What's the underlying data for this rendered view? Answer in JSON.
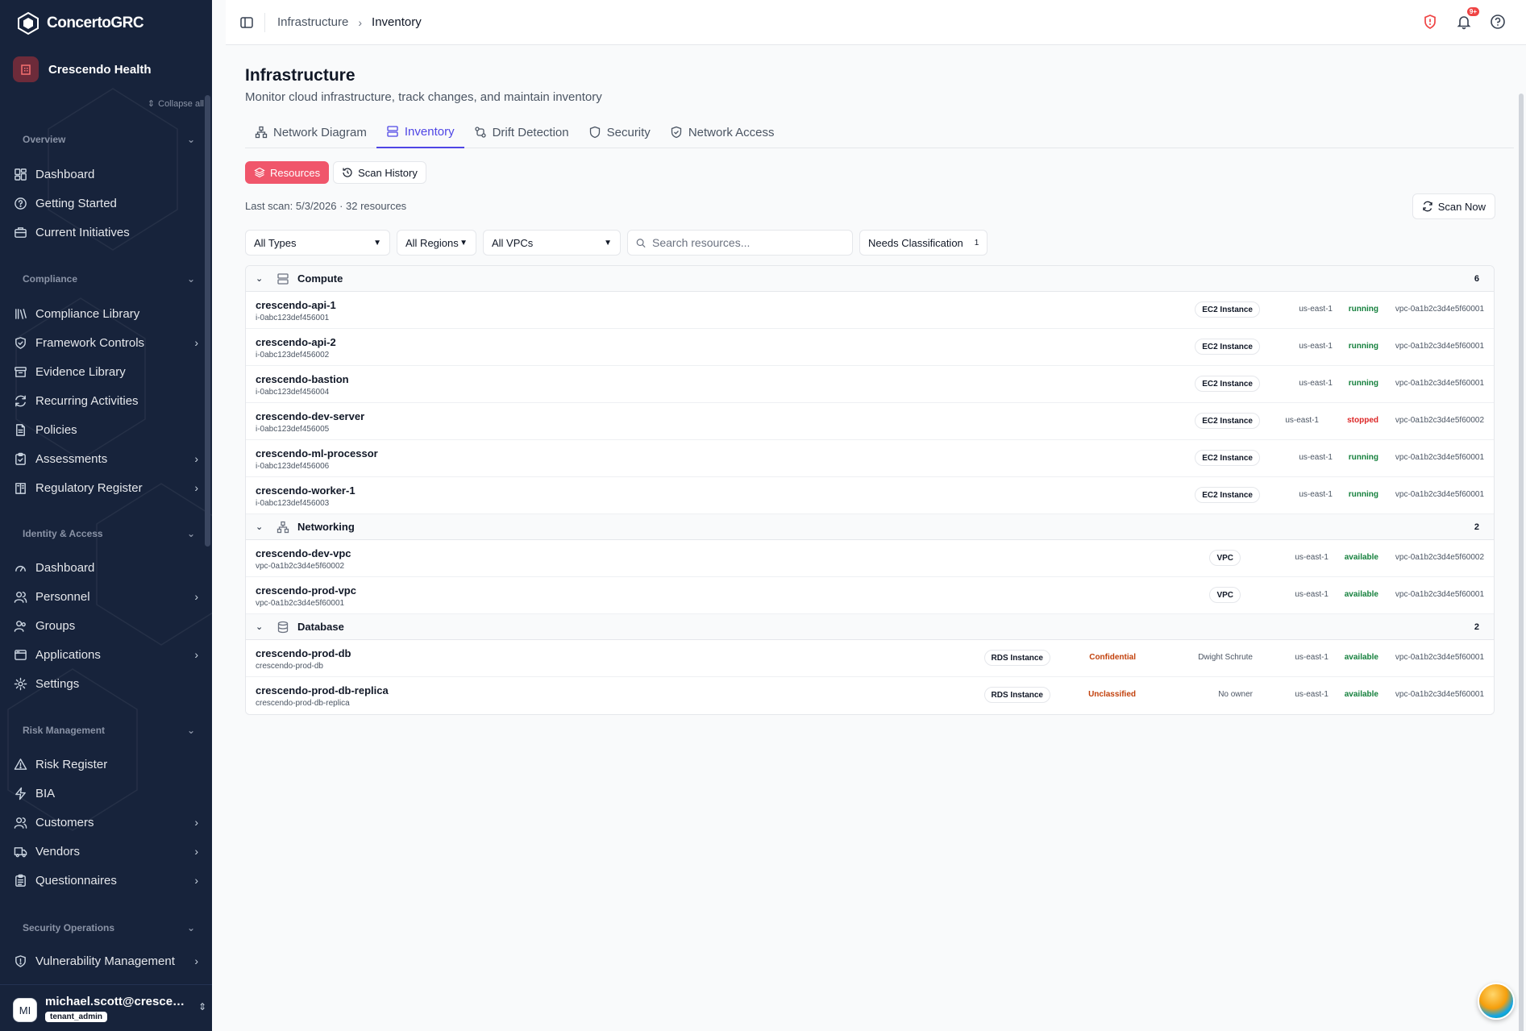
{
  "app": {
    "brand": "ConcertoGRC",
    "tenant": "Crescendo Health",
    "collapse_all": "Collapse all"
  },
  "sidebar": {
    "sections": [
      {
        "title": "Overview",
        "items": [
          {
            "label": "Dashboard",
            "icon": "dashboard-icon",
            "chevron": false
          },
          {
            "label": "Getting Started",
            "icon": "help-circle-icon",
            "chevron": false
          },
          {
            "label": "Current Initiatives",
            "icon": "briefcase-icon",
            "chevron": false
          }
        ]
      },
      {
        "title": "Compliance",
        "items": [
          {
            "label": "Compliance Library",
            "icon": "library-icon",
            "chevron": false
          },
          {
            "label": "Framework Controls",
            "icon": "shield-check-icon",
            "chevron": true
          },
          {
            "label": "Evidence Library",
            "icon": "archive-icon",
            "chevron": false
          },
          {
            "label": "Recurring Activities",
            "icon": "refresh-icon",
            "chevron": false
          },
          {
            "label": "Policies",
            "icon": "file-text-icon",
            "chevron": false
          },
          {
            "label": "Assessments",
            "icon": "clipboard-check-icon",
            "chevron": true
          },
          {
            "label": "Regulatory Register",
            "icon": "book-icon",
            "chevron": true
          }
        ]
      },
      {
        "title": "Identity & Access",
        "items": [
          {
            "label": "Dashboard",
            "icon": "gauge-icon",
            "chevron": false
          },
          {
            "label": "Personnel",
            "icon": "users-icon",
            "chevron": true
          },
          {
            "label": "Groups",
            "icon": "user-group-icon",
            "chevron": false
          },
          {
            "label": "Applications",
            "icon": "app-window-icon",
            "chevron": true
          },
          {
            "label": "Settings",
            "icon": "gear-icon",
            "chevron": false
          }
        ]
      },
      {
        "title": "Risk Management",
        "items": [
          {
            "label": "Risk Register",
            "icon": "alert-triangle-icon",
            "chevron": false
          },
          {
            "label": "BIA",
            "icon": "zap-icon",
            "chevron": false
          },
          {
            "label": "Customers",
            "icon": "users-icon",
            "chevron": true
          },
          {
            "label": "Vendors",
            "icon": "truck-icon",
            "chevron": true
          },
          {
            "label": "Questionnaires",
            "icon": "clipboard-list-icon",
            "chevron": true
          }
        ]
      },
      {
        "title": "Security Operations",
        "items": [
          {
            "label": "Vulnerability Management",
            "icon": "shield-alert-icon",
            "chevron": true
          }
        ]
      }
    ]
  },
  "user": {
    "initials": "MI",
    "email": "michael.scott@crescendo",
    "role": "tenant_admin"
  },
  "header": {
    "breadcrumb": [
      "Infrastructure",
      "Inventory"
    ],
    "notif_badge": "9+",
    "colors": {
      "alert": "#ef4444"
    }
  },
  "page": {
    "title": "Infrastructure",
    "subtitle": "Monitor cloud infrastructure, track changes, and maintain inventory",
    "tabs": [
      "Network Diagram",
      "Inventory",
      "Drift Detection",
      "Security",
      "Network Access"
    ],
    "active_tab": "Inventory",
    "subtabs": [
      "Resources",
      "Scan History"
    ],
    "last_scan": "Last scan: 5/3/2026 · 32 resources",
    "scan_now": "Scan Now",
    "filters": {
      "types": "All Types",
      "regions": "All Regions",
      "vpcs": "All VPCs"
    },
    "search_placeholder": "Search resources...",
    "needs_classification": {
      "label": "Needs Classification",
      "count": "1"
    }
  },
  "groups": [
    {
      "name": "Compute",
      "icon": "server-icon",
      "count": "6",
      "rows": [
        {
          "name": "crescendo-api-1",
          "id": "i-0abc123def456001",
          "type": "EC2 Instance",
          "region": "us-east-1",
          "status": "running",
          "vpc": "vpc-0a1b2c3d4e5f60001"
        },
        {
          "name": "crescendo-api-2",
          "id": "i-0abc123def456002",
          "type": "EC2 Instance",
          "region": "us-east-1",
          "status": "running",
          "vpc": "vpc-0a1b2c3d4e5f60001"
        },
        {
          "name": "crescendo-bastion",
          "id": "i-0abc123def456004",
          "type": "EC2 Instance",
          "region": "us-east-1",
          "status": "running",
          "vpc": "vpc-0a1b2c3d4e5f60001"
        },
        {
          "name": "crescendo-dev-server",
          "id": "i-0abc123def456005",
          "type": "EC2 Instance",
          "region": "us-east-1",
          "status": "stopped",
          "vpc": "vpc-0a1b2c3d4e5f60002"
        },
        {
          "name": "crescendo-ml-processor",
          "id": "i-0abc123def456006",
          "type": "EC2 Instance",
          "region": "us-east-1",
          "status": "running",
          "vpc": "vpc-0a1b2c3d4e5f60001"
        },
        {
          "name": "crescendo-worker-1",
          "id": "i-0abc123def456003",
          "type": "EC2 Instance",
          "region": "us-east-1",
          "status": "running",
          "vpc": "vpc-0a1b2c3d4e5f60001"
        }
      ]
    },
    {
      "name": "Networking",
      "icon": "network-icon",
      "count": "2",
      "rows": [
        {
          "name": "crescendo-dev-vpc",
          "id": "vpc-0a1b2c3d4e5f60002",
          "type": "VPC",
          "region": "us-east-1",
          "status": "available",
          "vpc": "vpc-0a1b2c3d4e5f60002"
        },
        {
          "name": "crescendo-prod-vpc",
          "id": "vpc-0a1b2c3d4e5f60001",
          "type": "VPC",
          "region": "us-east-1",
          "status": "available",
          "vpc": "vpc-0a1b2c3d4e5f60001"
        }
      ]
    },
    {
      "name": "Database",
      "icon": "database-icon",
      "count": "2",
      "rows": [
        {
          "name": "crescendo-prod-db",
          "id": "crescendo-prod-db",
          "type": "RDS Instance",
          "classification": "Confidential",
          "owner": "Dwight Schrute",
          "region": "us-east-1",
          "status": "available",
          "vpc": "vpc-0a1b2c3d4e5f60001"
        },
        {
          "name": "crescendo-prod-db-replica",
          "id": "crescendo-prod-db-replica",
          "type": "RDS Instance",
          "classification": "Unclassified",
          "owner": "No owner",
          "region": "us-east-1",
          "status": "available",
          "vpc": "vpc-0a1b2c3d4e5f60001"
        }
      ]
    }
  ],
  "status_colors": {
    "running": "#15803d",
    "available": "#15803d",
    "stopped": "#dc2626"
  }
}
